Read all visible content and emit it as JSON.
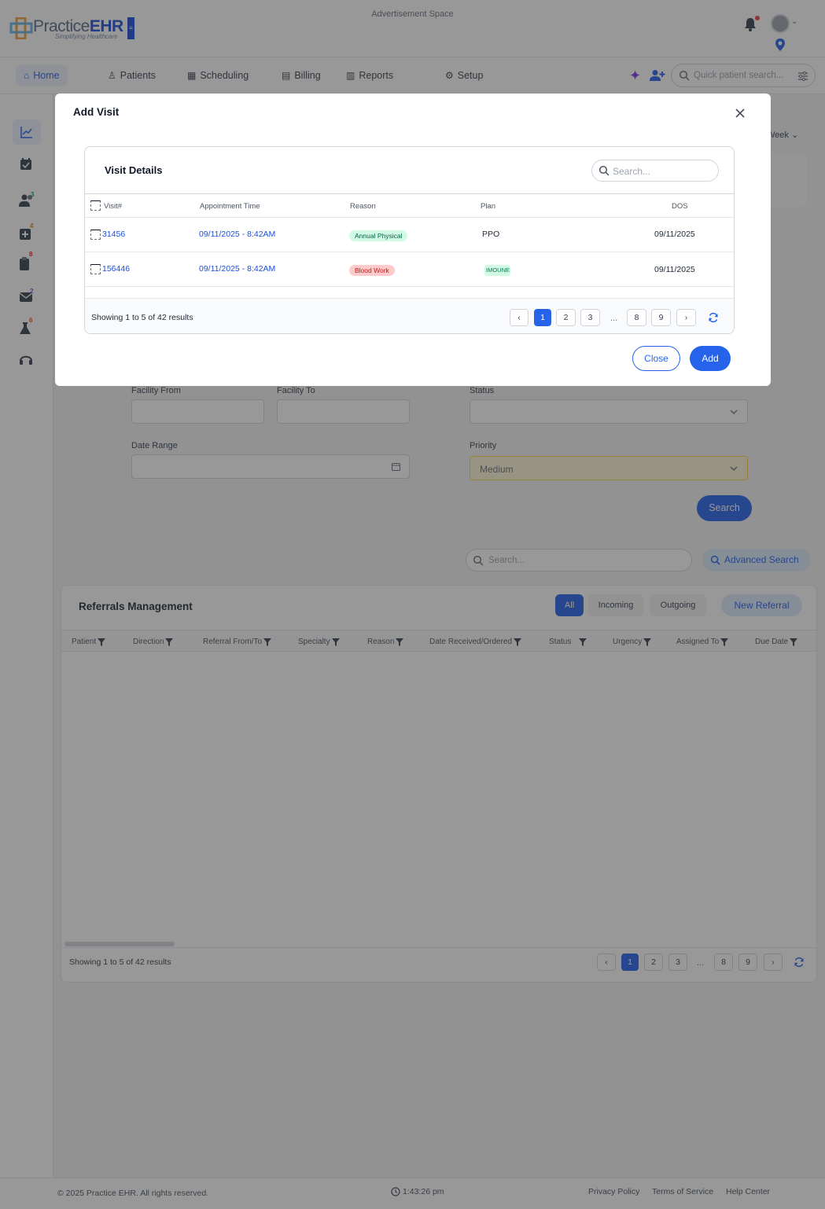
{
  "app": {
    "logo_text_a": "Practice",
    "logo_text_b": "EHR",
    "logo_tagline": "Simplifying Healthcare",
    "ad_space": "Advertisement Space"
  },
  "nav": {
    "items": [
      {
        "label": "Home",
        "icon": "home-icon"
      },
      {
        "label": "Patients",
        "icon": "patient-icon"
      },
      {
        "label": "Scheduling",
        "icon": "calendar-icon"
      },
      {
        "label": "Billing",
        "icon": "billing-icon"
      },
      {
        "label": "Reports",
        "icon": "chart-icon"
      },
      {
        "label": "Setup",
        "icon": "gear-icon"
      }
    ],
    "quick_search_placeholder": "Quick patient search...",
    "accent": "#2563eb"
  },
  "sidebar": {
    "badges": {
      "patients": "3",
      "rx": "4",
      "bills": "8",
      "messages": "2",
      "labs": "6"
    }
  },
  "filters": {
    "week_label": "Week",
    "facility_from_label": "Facility From",
    "facility_to_label": "Facility To",
    "status_label": "Status",
    "date_range_label": "Date Range",
    "priority_label": "Priority",
    "priority_value": "Medium",
    "search_button": "Search"
  },
  "list": {
    "search_placeholder": "Search...",
    "advanced_search": "Advanced Search"
  },
  "referrals": {
    "title": "Referrals Management",
    "tabs": [
      "All",
      "Incoming",
      "Outgoing"
    ],
    "active_tab": "All",
    "new_button": "New Referral",
    "columns": [
      "Patient",
      "Direction",
      "Referral From/To",
      "Specialty",
      "Reason",
      "Date Received/Ordered",
      "Status",
      "Urgency",
      "Assigned To",
      "Due Date"
    ],
    "showing": "Showing 1 to 5 of 42 results",
    "pages": [
      "1",
      "2",
      "3",
      "...",
      "8",
      "9"
    ]
  },
  "modal": {
    "title": "Add Visit",
    "card_title": "Visit Details",
    "search_placeholder": "Search...",
    "columns": [
      "Visit#",
      "Appointment Time",
      "Reason",
      "Plan",
      "DOS"
    ],
    "rows": [
      {
        "visit": "31456",
        "time": "09/11/2025 - 8:42AM",
        "reason": "Annual Physical",
        "reason_color": "green",
        "plan": "PPO",
        "dos": "09/11/2025"
      },
      {
        "visit": "156446",
        "time": "09/11/2025 - 8:42AM",
        "reason": "Blood Work",
        "reason_color": "red",
        "plan": "IMOUNE",
        "dos": "09/11/2025"
      }
    ],
    "showing": "Showing 1 to 5 of 42 results",
    "pages": [
      "1",
      "2",
      "3",
      "...",
      "8",
      "9"
    ],
    "close_button": "Close",
    "add_button": "Add"
  },
  "footer": {
    "copyright": "© 2025 Practice EHR. All rights reserved.",
    "time": "1:43:26 pm",
    "links": [
      "Privacy Policy",
      "Terms of Service",
      "Help Center"
    ]
  }
}
